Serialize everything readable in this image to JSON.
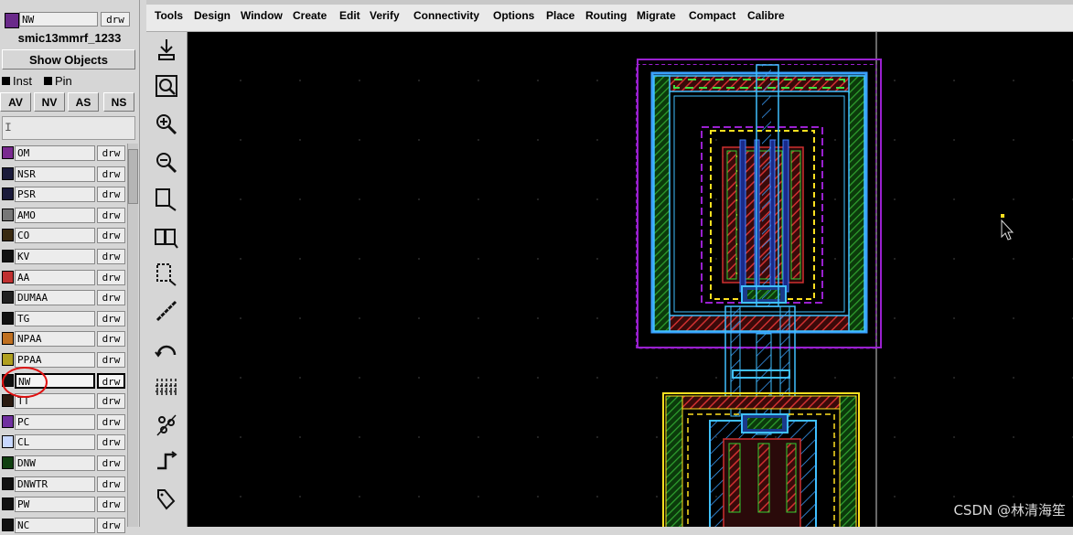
{
  "current_layer": {
    "name": "NW",
    "purpose": "drw",
    "color": "#6a2a8a"
  },
  "tech_library": "smic13mmrf_1233",
  "show_objects_label": "Show Objects",
  "checkboxes": [
    {
      "label": "Inst"
    },
    {
      "label": "Pin"
    }
  ],
  "visibility_buttons": [
    "AV",
    "NV",
    "AS",
    "NS"
  ],
  "filter_text": "I",
  "layers": [
    {
      "name": "OM",
      "purpose": "drw",
      "color": "#7a2a90"
    },
    {
      "name": "NSR",
      "purpose": "drw",
      "color": "#1a1a3a"
    },
    {
      "name": "PSR",
      "purpose": "drw",
      "color": "#1a1a3a"
    },
    {
      "name": "AMO",
      "purpose": "drw",
      "color": "#777777"
    },
    {
      "name": "CO",
      "purpose": "drw",
      "color": "#3a2a10"
    },
    {
      "name": "KV",
      "purpose": "drw",
      "color": "#101010"
    },
    {
      "name": "AA",
      "purpose": "drw",
      "color": "#c03030"
    },
    {
      "name": "DUMAA",
      "purpose": "drw",
      "color": "#202020"
    },
    {
      "name": "TG",
      "purpose": "drw",
      "color": "#101010"
    },
    {
      "name": "NPAA",
      "purpose": "drw",
      "color": "#c07020"
    },
    {
      "name": "PPAA",
      "purpose": "drw",
      "color": "#b0a020"
    },
    {
      "name": "NW",
      "purpose": "drw",
      "color": "#101010",
      "selected": true
    },
    {
      "name": "TT",
      "purpose": "drw",
      "color": "#2a1a10"
    },
    {
      "name": "PC",
      "purpose": "drw",
      "color": "#7030a0"
    },
    {
      "name": "CL",
      "purpose": "drw",
      "color": "#c8d8ff"
    },
    {
      "name": "DNW",
      "purpose": "drw",
      "color": "#104010"
    },
    {
      "name": "DNWTR",
      "purpose": "drw",
      "color": "#101010"
    },
    {
      "name": "PW",
      "purpose": "drw",
      "color": "#101010"
    },
    {
      "name": "NC",
      "purpose": "drw",
      "color": "#101010"
    }
  ],
  "menu": [
    "Tools",
    "Design",
    "Window",
    "Create",
    "Edit",
    "Verify",
    "Connectivity",
    "Options",
    "Place",
    "Routing",
    "Migrate",
    "Compact",
    "Calibre"
  ],
  "tools": [
    "save-icon",
    "fit-view-icon",
    "zoom-in-icon",
    "zoom-out-icon",
    "stretch-icon",
    "copy-icon",
    "move-icon",
    "ruler-icon",
    "undo-icon",
    "path-icon",
    "instance-icon",
    "wire-icon",
    "label-icon"
  ],
  "watermark": "CSDN @林清海笙"
}
